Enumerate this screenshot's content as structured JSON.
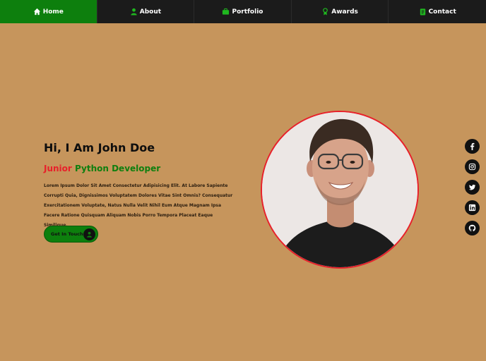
{
  "nav": {
    "items": [
      {
        "label": "Home",
        "icon": "home-icon",
        "active": true
      },
      {
        "label": "About",
        "icon": "user-icon",
        "active": false
      },
      {
        "label": "Portfolio",
        "icon": "briefcase-icon",
        "active": false
      },
      {
        "label": "Awards",
        "icon": "award-icon",
        "active": false
      },
      {
        "label": "Contact",
        "icon": "clipboard-icon",
        "active": false
      }
    ]
  },
  "hero": {
    "title": "Hi, I Am John Doe",
    "subtitle_prefix": "Junior",
    "subtitle_main": "Python Developer",
    "description": "Lorem Ipsum Dolor Sit Amet Consectetur Adipisicing Elit. At Labore Sapiente Corrupti Quia, Dignissimos Voluptatem Dolores Vitae Sint Omnis? Consequatur Exercitationem Voluptate, Natus Nulla Velit Nihil Eum Atque Magnam Ipsa Facere Ratione Quisquam Aliquam Nobis Porro Tempora Placeat Eaque Similique.",
    "cta_label": "Get In Touch"
  },
  "social": [
    {
      "icon": "facebook-icon"
    },
    {
      "icon": "instagram-icon"
    },
    {
      "icon": "twitter-icon"
    },
    {
      "icon": "linkedin-icon"
    },
    {
      "icon": "github-icon"
    }
  ],
  "colors": {
    "background": "#c6955c",
    "nav_bg": "#1b1b1b",
    "accent_green": "#0d7f0d",
    "accent_red": "#e8202a"
  }
}
